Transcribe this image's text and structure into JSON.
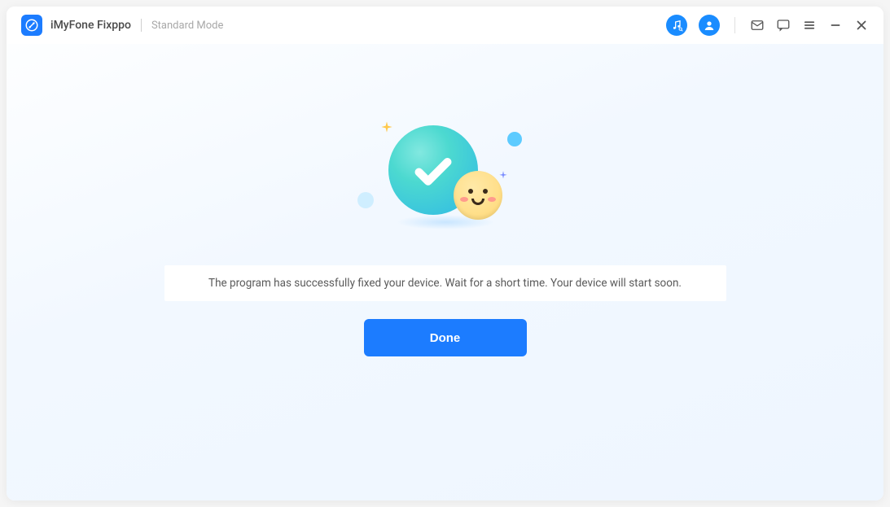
{
  "header": {
    "app_title": "iMyFone Fixppo",
    "mode": "Standard Mode"
  },
  "icons": {
    "music": "music-icon",
    "profile": "profile-icon",
    "mail": "mail-icon",
    "feedback": "feedback-icon",
    "menu": "menu-icon",
    "minimize": "minimize-icon",
    "close": "close-icon"
  },
  "result": {
    "message": "The program has successfully fixed your device. Wait for a short time. Your device will start soon.",
    "done_label": "Done"
  },
  "colors": {
    "primary": "#1C7CFF",
    "teal_gradient_start": "#82e8e0",
    "teal_gradient_end": "#2fb8e6"
  }
}
